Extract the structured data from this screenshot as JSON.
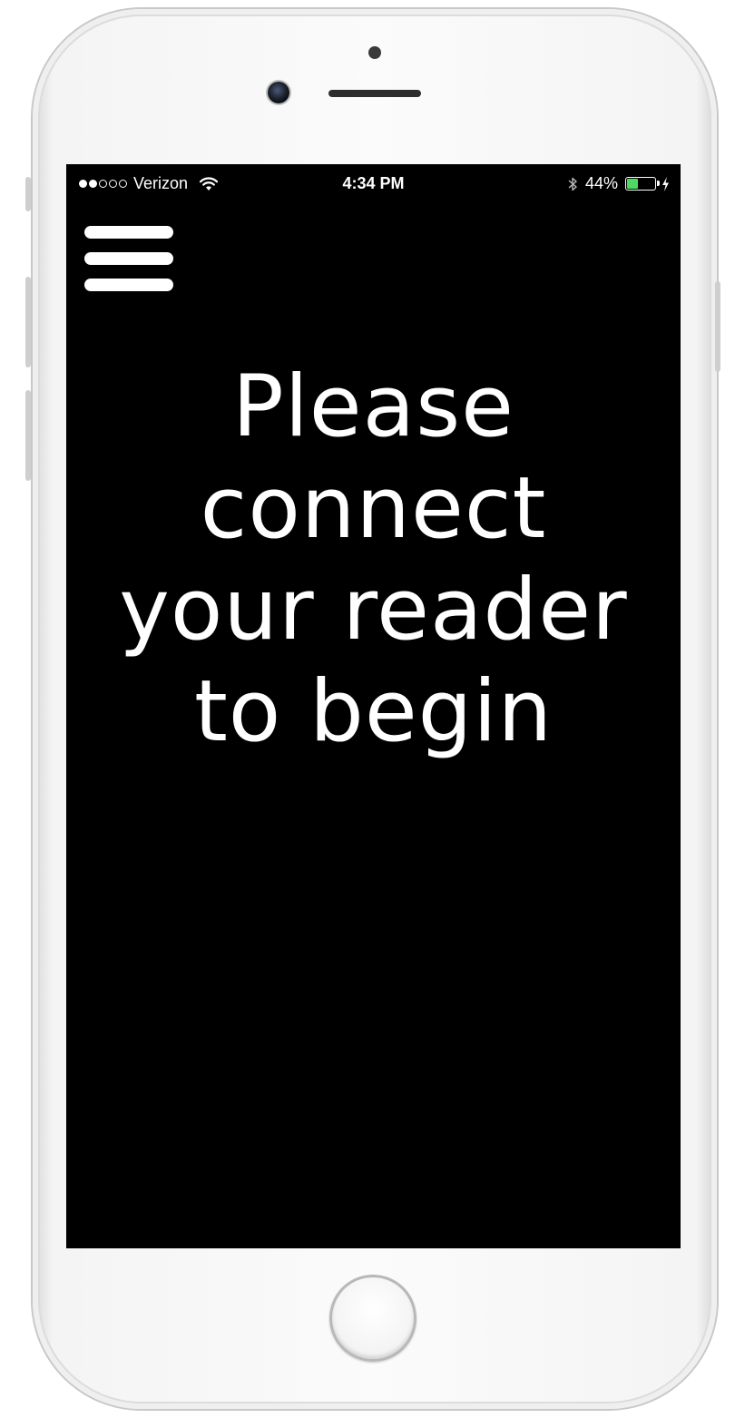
{
  "status_bar": {
    "carrier": "Verizon",
    "signal_strength": 2,
    "signal_max": 5,
    "time": "4:34 PM",
    "battery_percent": "44%",
    "battery_level": 0.44,
    "battery_color": "#4cd964",
    "icons": [
      "wifi-icon",
      "bluetooth-icon",
      "battery-icon",
      "charging-bolt-icon"
    ]
  },
  "menu": {
    "icon": "hamburger-menu-icon"
  },
  "message": {
    "lines": [
      "Please",
      "connect",
      "your reader",
      "to begin"
    ]
  },
  "colors": {
    "screen_background": "#000000",
    "text": "#ffffff",
    "device_body": "#f4f4f4"
  }
}
